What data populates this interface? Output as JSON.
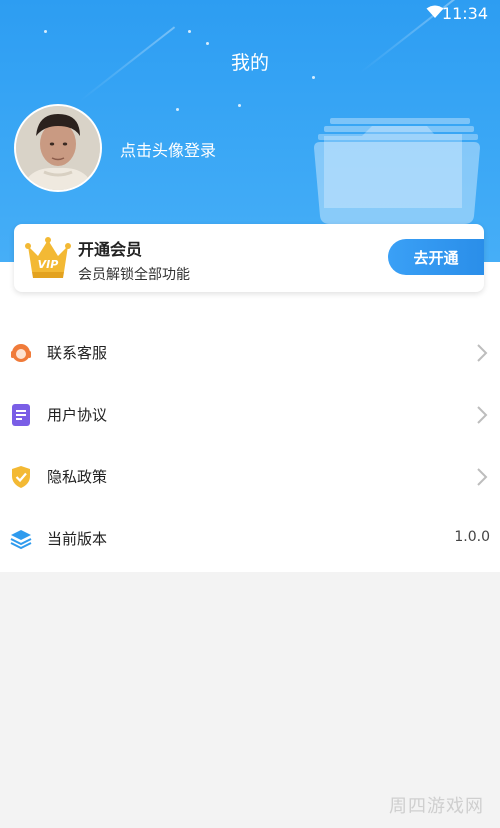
{
  "status_bar": {
    "time": "11:34"
  },
  "header": {
    "title": "我的",
    "login_prompt": "点击头像登录"
  },
  "vip": {
    "title": "开通会员",
    "subtitle": "会员解锁全部功能",
    "button_label": "去开通",
    "badge_text": "VIP"
  },
  "menu": {
    "items": [
      {
        "label": "联系客服",
        "icon": "headset-icon"
      },
      {
        "label": "用户协议",
        "icon": "document-icon"
      },
      {
        "label": "隐私政策",
        "icon": "shield-check-icon"
      },
      {
        "label": "当前版本",
        "icon": "layers-icon",
        "value": "1.0.0"
      }
    ]
  },
  "watermark": "周四游戏网",
  "colors": {
    "header_blue": "#3aa7f5",
    "accent": "#2a8ee9",
    "vip_gold": "#f3b934"
  }
}
